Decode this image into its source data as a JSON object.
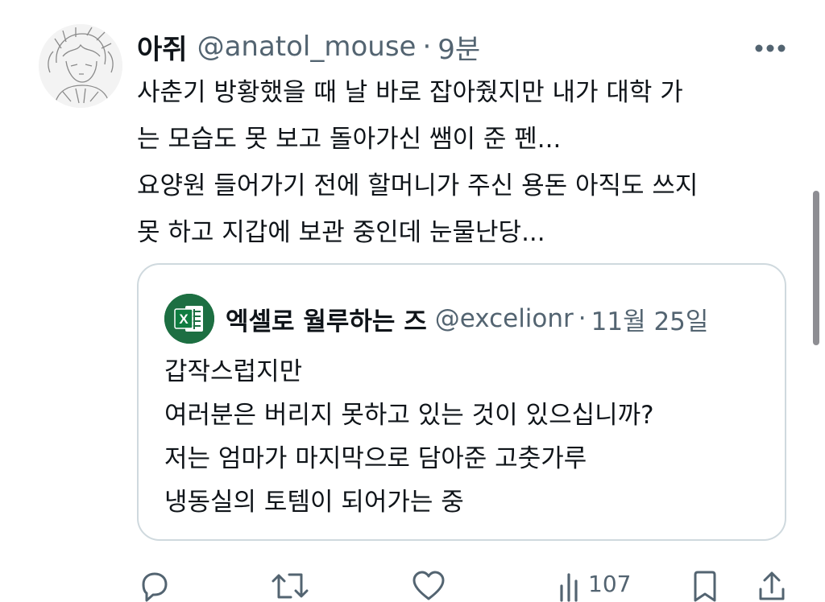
{
  "tweet": {
    "author_name": "아쥐",
    "handle": "@anatol_mouse",
    "separator": "·",
    "time": "9분",
    "lines": [
      "사춘기 방황했을 때 날 바로 잡아줬지만 내가 대학 가",
      "는 모습도 못 보고 돌아가신 쌤이 준 펜...",
      "요양원 들어가기 전에 할머니가 주신 용돈 아직도 쓰지",
      "못 하고 지갑에 보관 중인데 눈물난당..."
    ]
  },
  "quote": {
    "author_name": "엑셀로 월루하는 즈",
    "handle": "@excelionr",
    "separator": "·",
    "time": "11월 25일",
    "avatar_label": "X",
    "lines": [
      "갑작스럽지만",
      "여러분은 버리지 못하고 있는 것이 있으십니까?",
      "저는 엄마가 마지막으로 담아준 고춧가루",
      "냉동실의 토템이 되어가는 중"
    ]
  },
  "actions": {
    "views_count": "107",
    "icons": [
      "reply-icon",
      "retweet-icon",
      "like-icon",
      "views-icon",
      "bookmark-icon",
      "share-icon"
    ]
  },
  "colors": {
    "text": "#0f1419",
    "secondary": "#536471",
    "border": "#cfd9de",
    "excel_green": "#1d6f42"
  }
}
